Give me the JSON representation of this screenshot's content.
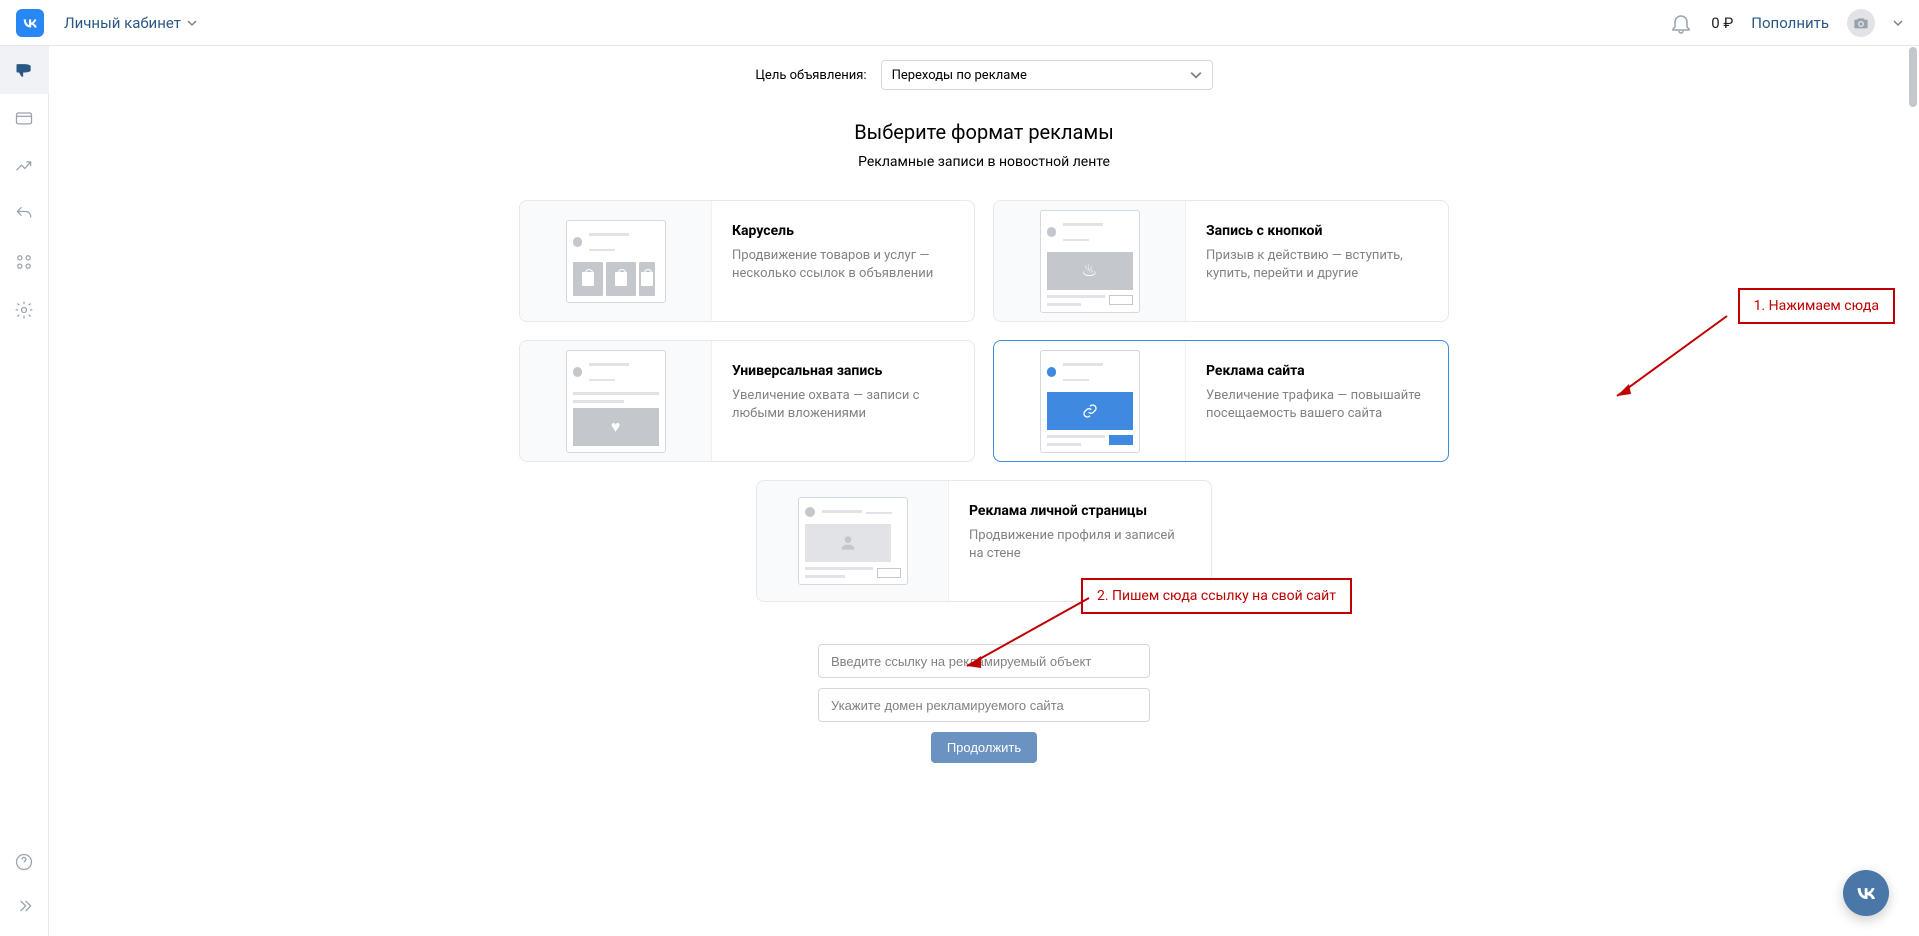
{
  "header": {
    "account_label": "Личный кабинет",
    "balance": "0 ₽",
    "topup": "Пополнить"
  },
  "goal": {
    "label": "Цель объявления:",
    "selected": "Переходы по рекламе"
  },
  "section": {
    "title": "Выберите формат рекламы",
    "subtitle": "Рекламные записи в новостной ленте"
  },
  "formats": {
    "carousel": {
      "title": "Карусель",
      "desc": "Продвижение товаров и услуг — несколько ссылок в объявлении"
    },
    "button": {
      "title": "Запись с кнопкой",
      "desc": "Призыв к действию — вступить, купить, перейти и другие"
    },
    "universal": {
      "title": "Универсальная запись",
      "desc": "Увеличение охвата — записи с любыми вложениями"
    },
    "site": {
      "title": "Реклама сайта",
      "desc": "Увеличение трафика — повышайте посещаемость вашего сайта"
    },
    "profile": {
      "title": "Реклама личной страницы",
      "desc": "Продвижение профиля и записей на стене"
    }
  },
  "inputs": {
    "link_placeholder": "Введите ссылку на рекламируемый объект",
    "domain_placeholder": "Укажите домен рекламируемого сайта",
    "continue": "Продолжить"
  },
  "annotations": {
    "a1": "1. Нажимаем сюда",
    "a2": "2. Пишем сюда ссылку на свой сайт"
  }
}
